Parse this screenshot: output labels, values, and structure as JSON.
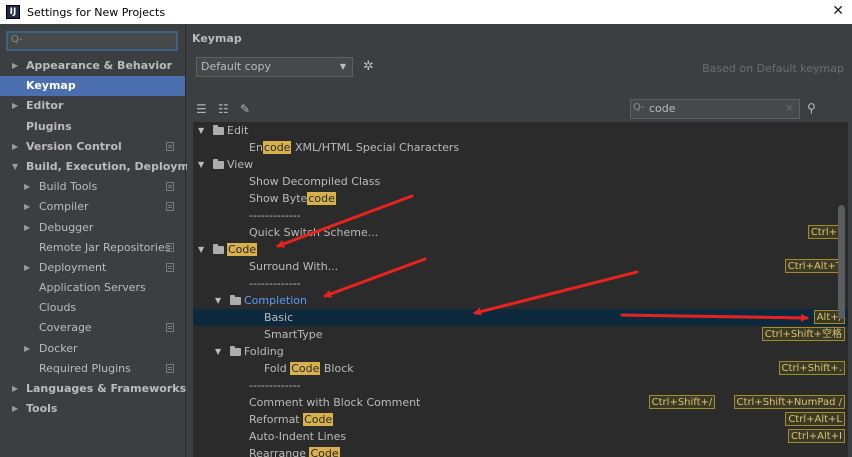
{
  "window": {
    "title": "Settings for New Projects",
    "app_icon": "IJ",
    "close_glyph": "✕"
  },
  "sidebar": {
    "search_icon": "Q-",
    "items": [
      {
        "label": "Appearance & Behavior",
        "arrow": "▶",
        "bold": true,
        "indent": 0
      },
      {
        "label": "Keymap",
        "arrow": "",
        "bold": true,
        "indent": 0,
        "selected": true
      },
      {
        "label": "Editor",
        "arrow": "▶",
        "bold": true,
        "indent": 0
      },
      {
        "label": "Plugins",
        "arrow": "",
        "bold": true,
        "indent": 0
      },
      {
        "label": "Version Control",
        "arrow": "▶",
        "bold": true,
        "indent": 0,
        "project": true
      },
      {
        "label": "Build, Execution, Deployment",
        "arrow": "▼",
        "bold": true,
        "indent": 0
      },
      {
        "label": "Build Tools",
        "arrow": "▶",
        "indent": 1,
        "project": true
      },
      {
        "label": "Compiler",
        "arrow": "▶",
        "indent": 1,
        "project": true
      },
      {
        "label": "Debugger",
        "arrow": "▶",
        "indent": 1
      },
      {
        "label": "Remote Jar Repositories",
        "arrow": "",
        "indent": 1,
        "project": true
      },
      {
        "label": "Deployment",
        "arrow": "▶",
        "indent": 1,
        "project": true
      },
      {
        "label": "Application Servers",
        "arrow": "",
        "indent": 1
      },
      {
        "label": "Clouds",
        "arrow": "",
        "indent": 1
      },
      {
        "label": "Coverage",
        "arrow": "",
        "indent": 1,
        "project": true
      },
      {
        "label": "Docker",
        "arrow": "▶",
        "indent": 1
      },
      {
        "label": "Required Plugins",
        "arrow": "",
        "indent": 1,
        "project": true
      },
      {
        "label": "Languages & Frameworks",
        "arrow": "▶",
        "bold": true,
        "indent": 0
      },
      {
        "label": "Tools",
        "arrow": "▶",
        "bold": true,
        "indent": 0
      }
    ]
  },
  "keymap": {
    "heading": "Keymap",
    "scheme_value": "Default copy",
    "based_on": "Based on Default keymap",
    "search_icon": "Q-",
    "search_value": "code",
    "clear_glyph": "×",
    "find_shortcut_icon": "find-by-shortcut-icon",
    "colors": {
      "highlight": "#d8b14d",
      "selection": "#0d293e",
      "arrow": "#e8231f",
      "accent": "#4b6eaf"
    }
  },
  "tree": [
    {
      "type": "folder",
      "arrow": "▼",
      "level": 0,
      "parts": [
        {
          "t": "Edit"
        }
      ]
    },
    {
      "type": "action",
      "level": 2,
      "parts": [
        {
          "t": "En"
        },
        {
          "t": "code",
          "hl": true
        },
        {
          "t": " XML/HTML Special Characters"
        }
      ]
    },
    {
      "type": "folder",
      "arrow": "▼",
      "level": 0,
      "parts": [
        {
          "t": "View"
        }
      ]
    },
    {
      "type": "action",
      "level": 2,
      "parts": [
        {
          "t": "Show Decompiled Class"
        }
      ]
    },
    {
      "type": "action",
      "level": 2,
      "parts": [
        {
          "t": "Show Byte"
        },
        {
          "t": "code",
          "hl": true
        }
      ]
    },
    {
      "type": "action",
      "level": 2,
      "parts": [
        {
          "t": "-------------"
        }
      ]
    },
    {
      "type": "action",
      "level": 2,
      "parts": [
        {
          "t": "Quick Switch Scheme..."
        }
      ],
      "shortcuts": [
        "Ctrl+`"
      ]
    },
    {
      "type": "folder",
      "arrow": "▼",
      "level": 0,
      "parts": [
        {
          "t": "Code",
          "hl": true
        }
      ]
    },
    {
      "type": "action",
      "level": 2,
      "parts": [
        {
          "t": "Surround With..."
        }
      ],
      "shortcuts": [
        "Ctrl+Alt+T"
      ]
    },
    {
      "type": "action",
      "level": 2,
      "parts": [
        {
          "t": "-------------"
        }
      ]
    },
    {
      "type": "folder",
      "arrow": "▼",
      "level": 1,
      "blue": true,
      "parts": [
        {
          "t": "Completion"
        }
      ]
    },
    {
      "type": "action",
      "level": 3,
      "selected": true,
      "parts": [
        {
          "t": "Basic"
        }
      ],
      "shortcuts": [
        "Alt+/"
      ]
    },
    {
      "type": "action",
      "level": 3,
      "parts": [
        {
          "t": "SmartType"
        }
      ],
      "shortcuts": [
        "Ctrl+Shift+空格"
      ]
    },
    {
      "type": "folder",
      "arrow": "▼",
      "level": 1,
      "parts": [
        {
          "t": "Folding"
        }
      ]
    },
    {
      "type": "action",
      "level": 3,
      "parts": [
        {
          "t": "Fold "
        },
        {
          "t": "Code",
          "hl": true
        },
        {
          "t": " Block"
        }
      ],
      "shortcuts": [
        "Ctrl+Shift+."
      ]
    },
    {
      "type": "action",
      "level": 2,
      "parts": [
        {
          "t": "-------------"
        }
      ]
    },
    {
      "type": "action",
      "level": 2,
      "parts": [
        {
          "t": "Comment with Block Comment"
        }
      ],
      "shortcuts": [
        "Ctrl+Shift+/",
        "Ctrl+Shift+NumPad /"
      ]
    },
    {
      "type": "action",
      "level": 2,
      "parts": [
        {
          "t": "Reformat "
        },
        {
          "t": "Code",
          "hl": true
        }
      ],
      "shortcuts": [
        "Ctrl+Alt+L"
      ]
    },
    {
      "type": "action",
      "level": 2,
      "parts": [
        {
          "t": "Auto-Indent Lines"
        }
      ],
      "shortcuts": [
        "Ctrl+Alt+I"
      ]
    },
    {
      "type": "action",
      "level": 2,
      "parts": [
        {
          "t": "Rearrange "
        },
        {
          "t": "Code",
          "hl": true
        }
      ]
    }
  ]
}
